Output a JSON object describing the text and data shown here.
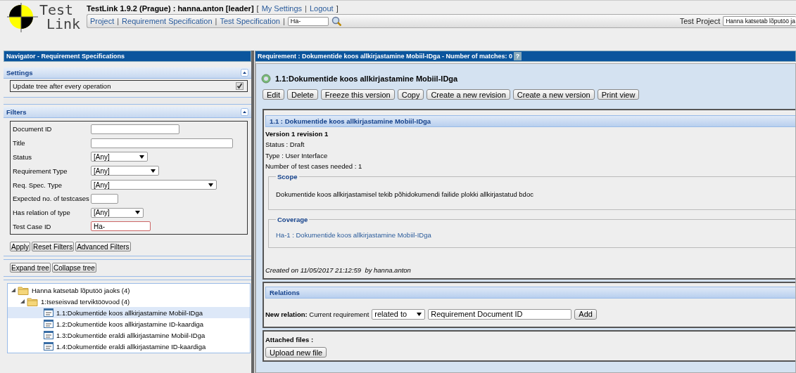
{
  "header": {
    "logo": [
      "Test",
      "Link"
    ],
    "title": "TestLink 1.9.2 (Prague) : hanna.anton [leader]",
    "brackets": [
      "[",
      "]"
    ],
    "separator": "|",
    "user_links": [
      "My Settings",
      "Logout"
    ],
    "nav_links": [
      "Project",
      "Requirement Specification",
      "Test Specification"
    ],
    "search_value": "Ha-",
    "test_project_label": "Test Project",
    "test_project_value": "Hanna katsetab lõputöö ja"
  },
  "navigator": {
    "title": "Navigator - Requirement Specifications",
    "settings": {
      "title": "Settings",
      "expanded": true,
      "options": [
        {
          "label": "Update tree after every operation",
          "checked": true
        }
      ]
    },
    "filters": {
      "title": "Filters",
      "expanded": true,
      "fields": [
        {
          "label": "Document ID",
          "kind": "text"
        },
        {
          "label": "Title",
          "kind": "text"
        },
        {
          "label": "Status",
          "kind": "select",
          "value": "[Any]"
        },
        {
          "label": "Requirement Type",
          "kind": "select",
          "value": "[Any]"
        },
        {
          "label": "Req. Spec. Type",
          "kind": "select",
          "value": "[Any]"
        },
        {
          "label": "Expected no. of testcases",
          "kind": "text"
        },
        {
          "label": "Has relation of type",
          "kind": "select",
          "value": "[Any]"
        },
        {
          "label": "Test Case ID",
          "kind": "text",
          "value": "Ha-"
        }
      ],
      "buttons": [
        "Apply",
        "Reset Filters",
        "Advanced Filters"
      ]
    },
    "tree_buttons": [
      "Expand tree",
      "Collapse tree"
    ],
    "tree": [
      {
        "label": "Hanna katsetab lõputöö jaoks (4)",
        "kind": "folder",
        "expanded": true,
        "selected": false,
        "children": [
          {
            "label": "1:Iseseisvad terviktöövood (4)",
            "kind": "folder",
            "expanded": true,
            "selected": false,
            "children": [
              {
                "label": "1.1:Dokumentide koos allkirjastamine Mobiil-IDga",
                "kind": "requirement",
                "selected": true
              },
              {
                "label": "1.2:Dokumentide koos allkirjastamine ID-kaardiga",
                "kind": "requirement",
                "selected": false
              },
              {
                "label": "1.3:Dokumentide eraldi allkirjastamine Mobiil-IDga",
                "kind": "requirement",
                "selected": false
              },
              {
                "label": "1.4:Dokumentide eraldi allkirjastamine ID-kaardiga",
                "kind": "requirement",
                "selected": false
              }
            ]
          }
        ]
      }
    ]
  },
  "requirement": {
    "title": "Requirement : Dokumentide koos allkirjastamine Mobiil-IDga - Number of matches: 0",
    "help": "?",
    "heading": "1.1:Dokumentide koos allkirjastamine Mobiil-IDga",
    "buttons": [
      "Edit",
      "Delete",
      "Freeze this version",
      "Copy",
      "Create a new revision",
      "Create a new version",
      "Print view"
    ],
    "detail": {
      "title": "1.1 : Dokumentide koos allkirjastamine Mobiil-IDga",
      "version": "Version 1 revision 1",
      "properties": [
        "Status : Draft",
        "Type : User Interface",
        "Number of test cases needed : 1"
      ],
      "scope_title": "Scope",
      "scope": "Dokumentide koos allkirjastamisel tekib põhidokumendi failide plokki allkirjastatud bdoc",
      "coverage_title": "Coverage",
      "coverage": [
        "Ha-1 : Dokumentide koos allkirjastamine Mobiil-IDga"
      ],
      "created": "Created on 11/05/2017 21:12:59  by hanna.anton"
    },
    "relations": {
      "title": "Relations",
      "label": "New relation:",
      "current": "Current requirement",
      "type": "related to",
      "target_value": "Requirement Document ID",
      "button": "Add"
    },
    "attachments": {
      "title": "Attached files :",
      "button": "Upload new file"
    }
  }
}
